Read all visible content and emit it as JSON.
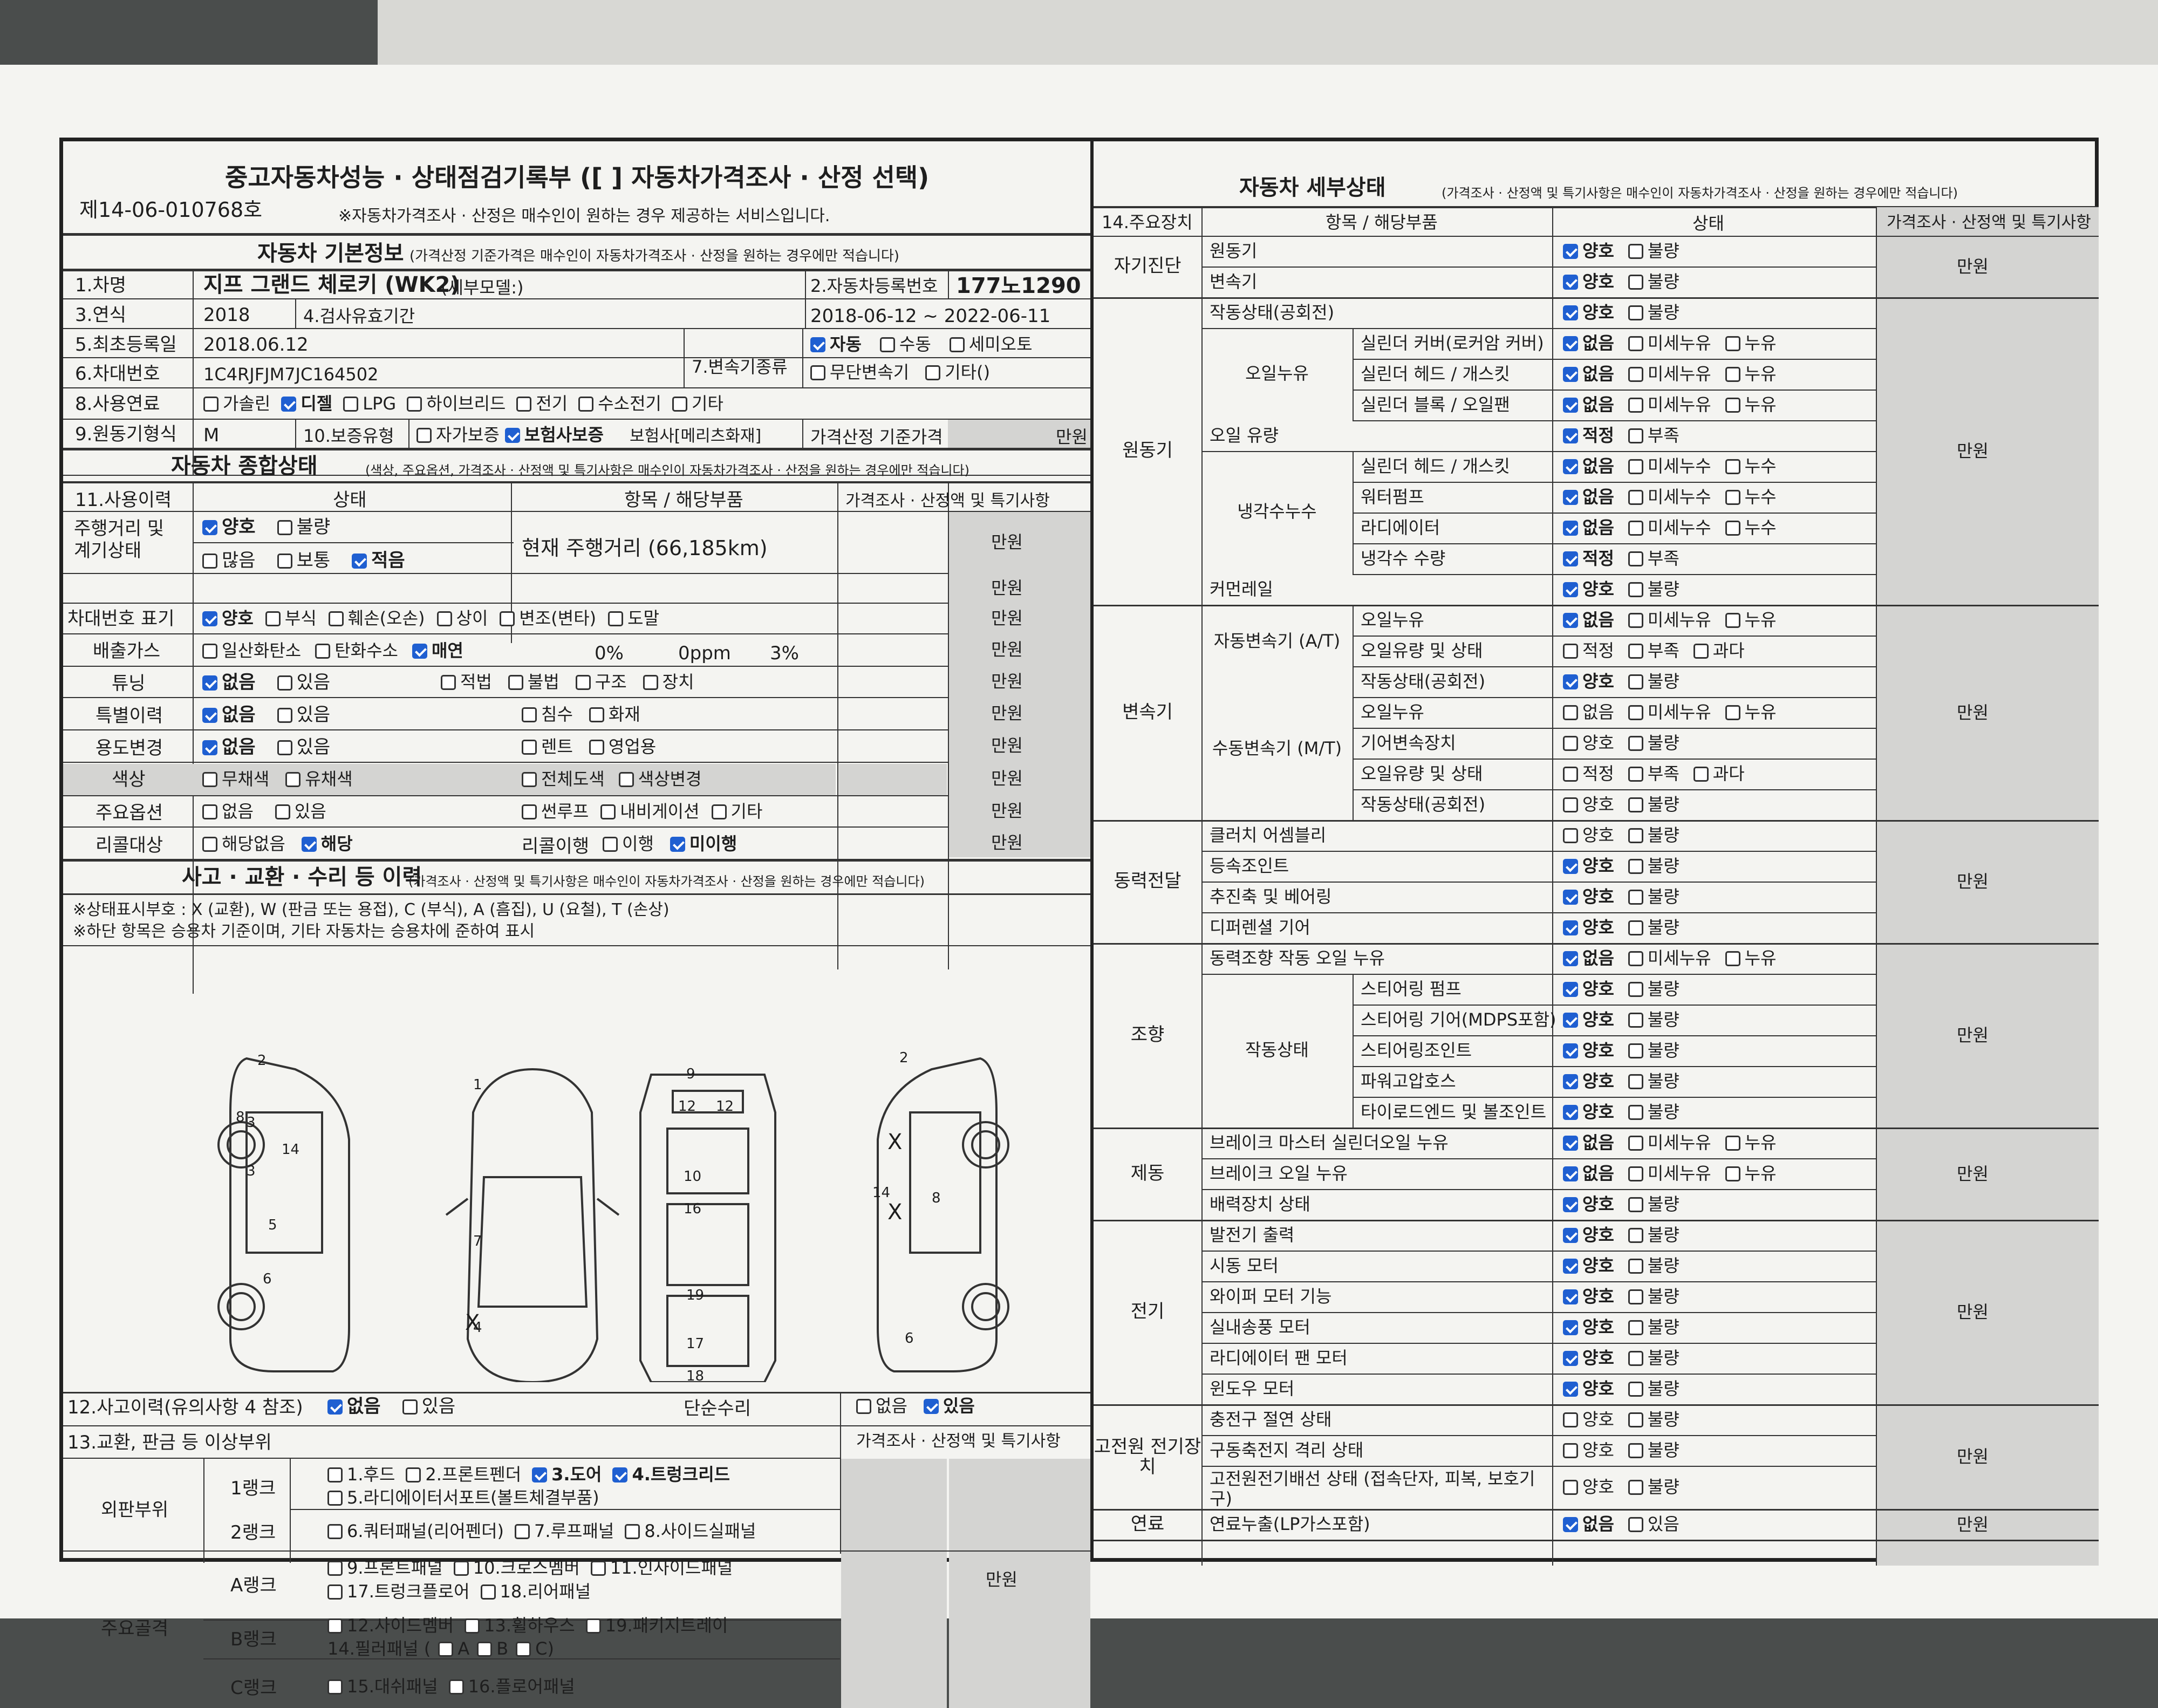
{
  "header": {
    "title": "중고자동차성능 · 상태점검기록부 ([    ] 자동차가격조사 · 산정 선택)",
    "doc_no": "제14-06-010768호",
    "notice": "※자동차가격조사 · 산정은 매수인이 원하는 경우 제공하는 서비스입니다."
  },
  "basic": {
    "title": "자동차 기본정보",
    "note": "(가격산정 기준가격은 매수인이 자동차가격조사 · 산정을 원하는 경우에만 적습니다)",
    "name_label": "1.차명",
    "name_value": "지프 그랜드 체로키 (WK2)",
    "detail_model": "(세부모델:)",
    "reg_no_label": "2.자동차등록번호",
    "reg_no_value": "177노1290",
    "year_label": "3.연식",
    "year_value": "2018",
    "inspection_label": "4.검사유효기간",
    "inspection_value": "2018-06-12 ~ 2022-06-11",
    "first_reg_label": "5.최초등록일",
    "first_reg_value": "2018.06.12",
    "vin_label": "6.차대번호",
    "vin_value": "1C4RJFJM7JC164502",
    "trans_label": "7.변속기종류",
    "trans_options": [
      "자동",
      "수동",
      "세미오토",
      "무단변속기",
      "기타()"
    ],
    "fuel_label": "8.사용연료",
    "fuel_options": [
      "가솔린",
      "디젤",
      "LPG",
      "하이브리드",
      "전기",
      "수소전기",
      "기타"
    ],
    "engine_label": "9.원동기형식",
    "engine_value": "M",
    "warranty_label": "10.보증유형",
    "warranty_self": "자가보증",
    "warranty_ins": "보험사보증",
    "insurer": "보험사[메리츠화재]",
    "price_label": "가격산정 기준가격",
    "unit": "만원"
  },
  "overall": {
    "title": "자동차 종합상태",
    "note": "(색상, 주요옵션, 가격조사 · 산정액 및 특기사항은 매수인이 자동차가격조사 · 산정을 원하는 경우에만 적습니다)",
    "col_history": "11.사용이력",
    "col_status": "상태",
    "col_item": "항목 / 해당부품",
    "col_price": "가격조사 · 산정액 및 특기사항",
    "mileage_label": "주행거리 및 계기상태",
    "mileage_value": "현재 주행거리 (66,185km)",
    "vin_stamp_label": "차대번호 표기",
    "emission_label": "배출가스",
    "emission_vals": [
      "0%",
      "0ppm",
      "3%"
    ],
    "tuning_label": "튜닝",
    "special_label": "특별이력",
    "usage_label": "용도변경",
    "color_label": "색상",
    "option_label": "주요옵션",
    "recall_label": "리콜대상",
    "recall_do_label": "리콜이행"
  },
  "accident": {
    "title": "사고 · 교환 · 수리 등 이력",
    "note": "(가격조사 · 산정액 및 특기사항은 매수인이 자동차가격조사 · 산정을 원하는 경우에만 적습니다)",
    "legend1": "※상태표시부호 : X (교환), W (판금 또는 용접), C (부식), A (흠집), U (요철), T (손상)",
    "legend2": "※하단 항목은 승용차 기준이며, 기타 자동차는 승용차에 준하여 표시",
    "history_label": "12.사고이력(유의사항 4 참조)",
    "simple_repair": "단순수리",
    "exchange_label": "13.교환, 판금 등 이상부위",
    "price_col": "가격조사 · 산정액 및 특기사항",
    "outer_panel": "외판부위",
    "main_frame": "주요골격",
    "rank1": "1랭크",
    "rank2": "2랭크",
    "rankA": "A랭크",
    "rankB": "B랭크",
    "rankC": "C랭크",
    "r1_line1": [
      "1.후드",
      "2.프론트펜더",
      "3.도어",
      "4.트렁크리드"
    ],
    "r1_line2": [
      "5.라디에이터서포트(볼트체결부품)"
    ],
    "r2_line": [
      "6.쿼터패널(리어펜더)",
      "7.루프패널",
      "8.사이드실패널"
    ],
    "rA_line1": [
      "9.프론트패널",
      "10.크로스멤버",
      "11.인사이드패널"
    ],
    "rA_line2": [
      "17.트렁크플로어",
      "18.리어패널"
    ],
    "rB_line1": [
      "12.사이드멤버",
      "13.휠하우스",
      "19.패키지트레이"
    ],
    "rB_line2": [
      "14.필러패널 (",
      "A",
      "B",
      "C)"
    ],
    "rC_line": [
      "15.대쉬패널",
      "16.플로어패널"
    ],
    "unit": "만원",
    "diagram_marks": "X"
  },
  "detail": {
    "title": "자동차 세부상태",
    "note": "(가격조사 · 산정액 및 특기사항은 매수인이 자동차가격조사 · 산정을 원하는 경우에만 적습니다)",
    "col_main": "14.주요장치",
    "col_item": "항목 / 해당부품",
    "col_state": "상태",
    "col_price": "가격조사 · 산정액 및 특기사항",
    "unit": "만원",
    "groups": [
      "자기진단",
      "원동기",
      "변속기",
      "동력전달",
      "조향",
      "제동",
      "전기",
      "고전원 전기장치",
      "연료"
    ]
  },
  "colors": {
    "check": "#1f5fd1",
    "gray_cell": "#d4d4d2",
    "line": "#222222"
  }
}
